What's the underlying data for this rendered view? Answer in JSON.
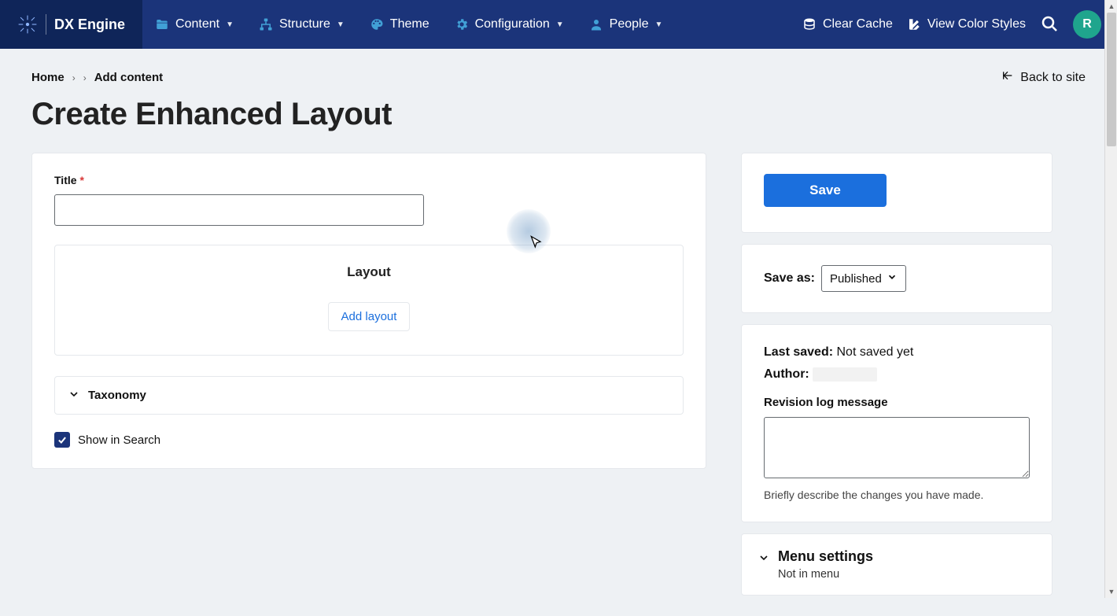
{
  "brand": {
    "name": "DX Engine"
  },
  "nav": {
    "items": [
      {
        "label": "Content"
      },
      {
        "label": "Structure"
      },
      {
        "label": "Theme"
      },
      {
        "label": "Configuration"
      },
      {
        "label": "People"
      }
    ],
    "clear_cache": "Clear Cache",
    "view_colors": "View Color Styles",
    "avatar_initial": "R"
  },
  "breadcrumbs": {
    "home": "Home",
    "add_content": "Add content",
    "back_to_site": "Back to site"
  },
  "page_title": "Create Enhanced Layout",
  "form": {
    "title_label": "Title",
    "title_value": "",
    "layout_heading": "Layout",
    "add_layout": "Add layout",
    "taxonomy": "Taxonomy",
    "show_in_search": "Show in Search",
    "show_in_search_checked": true
  },
  "sidebar": {
    "save": "Save",
    "save_as_label": "Save as:",
    "save_as_value": "Published",
    "last_saved_label": "Last saved:",
    "last_saved_value": "Not saved yet",
    "author_label": "Author:",
    "revision_label": "Revision log message",
    "revision_value": "",
    "revision_help": "Briefly describe the changes you have made.",
    "menu_settings_title": "Menu settings",
    "menu_settings_sub": "Not in menu"
  }
}
